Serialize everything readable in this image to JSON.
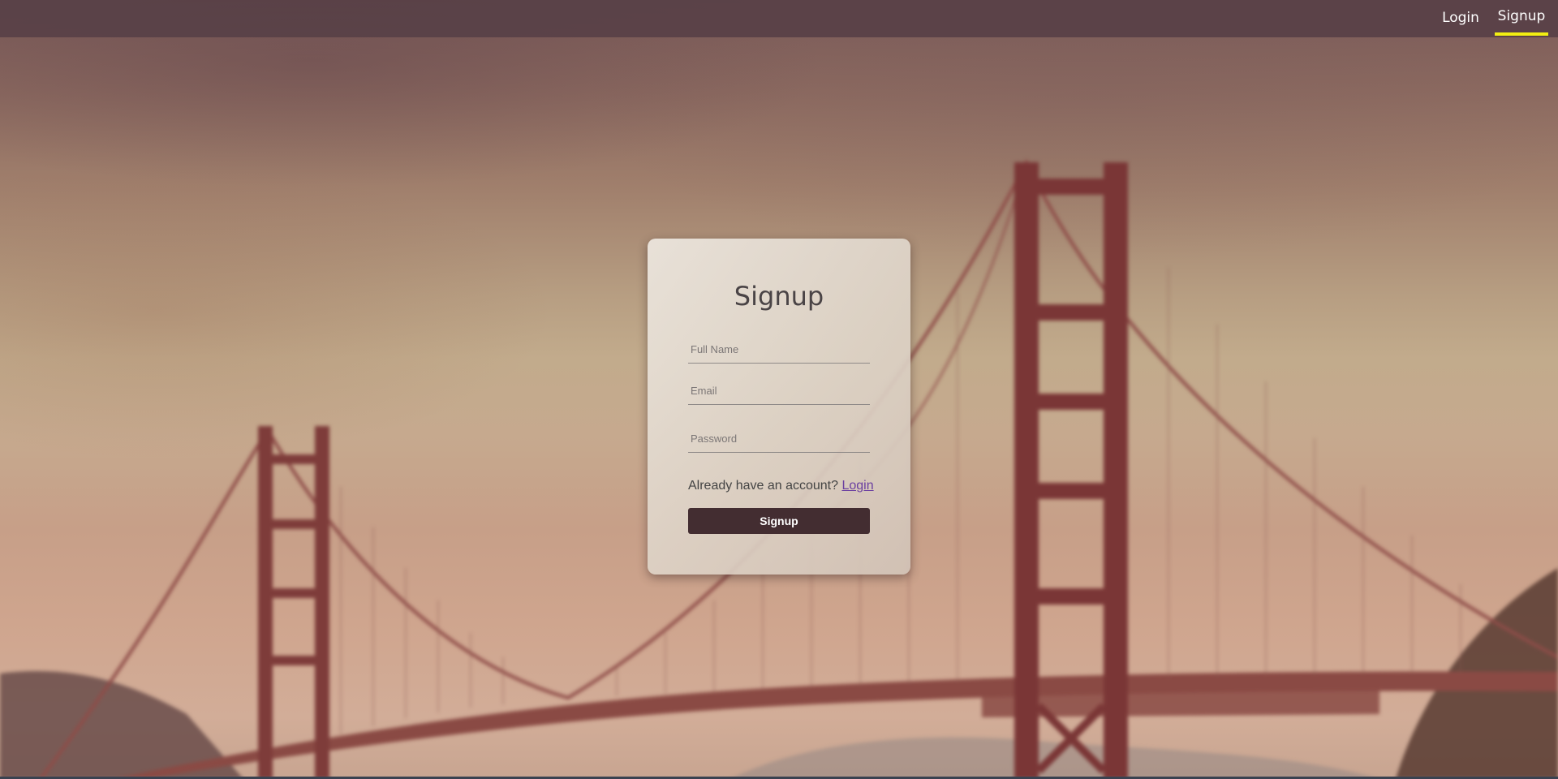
{
  "nav": {
    "login_label": "Login",
    "signup_label": "Signup",
    "active_tab": "Signup",
    "active_underline_color": "#f2ef12"
  },
  "form": {
    "title": "Signup",
    "full_name_placeholder": "Full Name",
    "email_placeholder": "Email",
    "password_placeholder": "Password",
    "account_prompt": "Already have an account?",
    "login_link": "Login",
    "submit_label": "Signup",
    "button_color": "#432d31"
  }
}
